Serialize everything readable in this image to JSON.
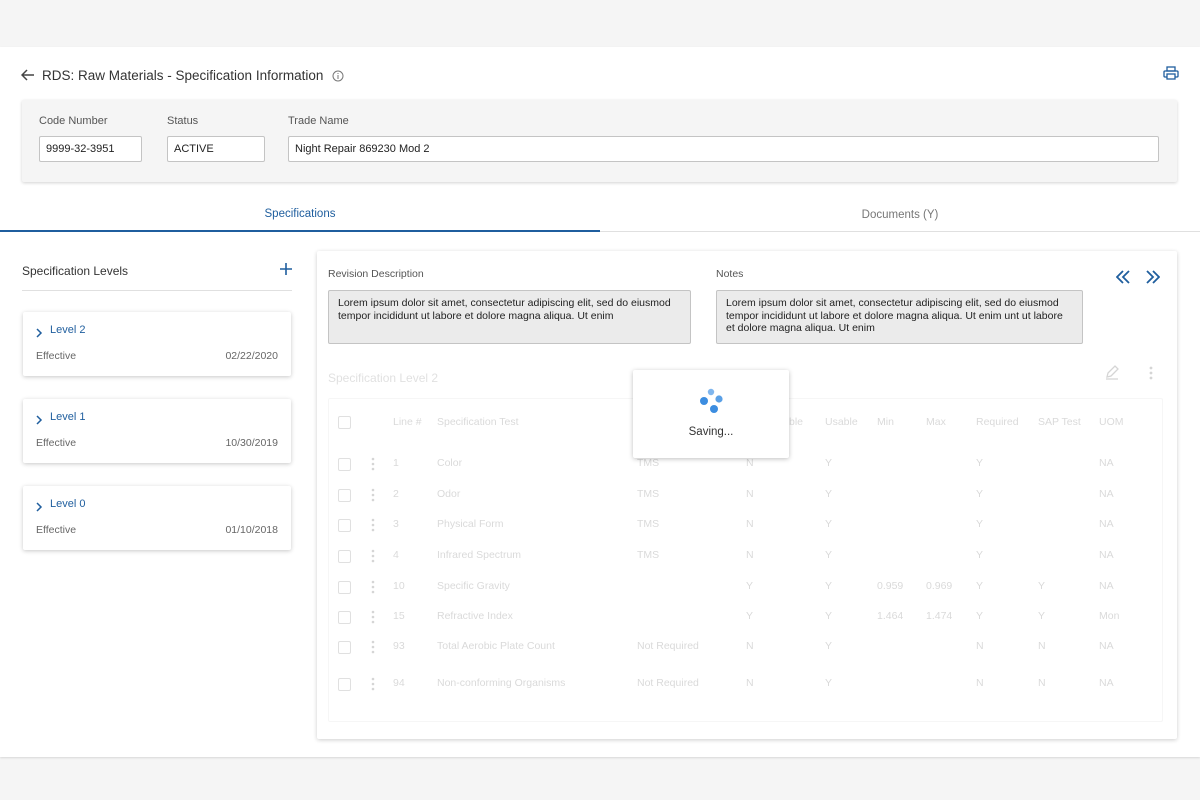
{
  "header": {
    "title": "RDS: Raw Materials - Specification Information",
    "accent_color": "#1f5e9e"
  },
  "fields": {
    "code_number": {
      "label": "Code Number",
      "value": "9999-32-3951"
    },
    "status": {
      "label": "Status",
      "value": "ACTIVE"
    },
    "trade_name": {
      "label": "Trade Name",
      "value": "Night Repair 869230 Mod 2"
    }
  },
  "tabs": [
    {
      "label": "Specifications",
      "active": true
    },
    {
      "label": "Documents (Y)",
      "active": false
    }
  ],
  "spec_levels": {
    "title": "Specification Levels",
    "items": [
      {
        "name": "Level 2",
        "status": "Effective",
        "date": "02/22/2020"
      },
      {
        "name": "Level 1",
        "status": "Effective",
        "date": "10/30/2019"
      },
      {
        "name": "Level 0",
        "status": "Effective",
        "date": "01/10/2018"
      }
    ]
  },
  "detail": {
    "revision_label": "Revision Description",
    "revision_text": "Lorem ipsum dolor sit amet, consectetur adipiscing elit, sed do eiusmod tempor incididunt ut labore et dolore magna aliqua. Ut enim",
    "notes_label": "Notes",
    "notes_text": "Lorem ipsum dolor sit amet, consectetur adipiscing elit, sed do eiusmod tempor incididunt ut labore et dolore magna aliqua. Ut enim unt ut labore et dolore magna aliqua. Ut enim",
    "spec_title": "Specification Level 2"
  },
  "table": {
    "headers": [
      "Line #",
      "Specification Test",
      "",
      "",
      "Usable",
      "Min",
      "Max",
      "Required",
      "SAP Test",
      "UOM"
    ],
    "header_partial_usable": "ble",
    "rows": [
      {
        "line": "1",
        "test": "Color",
        "method": "TMS",
        "c1": "N",
        "usable": "Y",
        "min": "",
        "max": "",
        "required": "Y",
        "sap": "",
        "uom": "NA"
      },
      {
        "line": "2",
        "test": "Odor",
        "method": "TMS",
        "c1": "N",
        "usable": "Y",
        "min": "",
        "max": "",
        "required": "Y",
        "sap": "",
        "uom": "NA"
      },
      {
        "line": "3",
        "test": "Physical Form",
        "method": "TMS",
        "c1": "N",
        "usable": "Y",
        "min": "",
        "max": "",
        "required": "Y",
        "sap": "",
        "uom": "NA"
      },
      {
        "line": "4",
        "test": "Infrared Spectrum",
        "method": "TMS",
        "c1": "N",
        "usable": "Y",
        "min": "",
        "max": "",
        "required": "Y",
        "sap": "",
        "uom": "NA"
      },
      {
        "line": "10",
        "test": "Specific Gravity",
        "method": "",
        "c1": "Y",
        "usable": "Y",
        "min": "0.959",
        "max": "0.969",
        "required": "Y",
        "sap": "Y",
        "uom": "NA"
      },
      {
        "line": "15",
        "test": "Refractive Index",
        "method": "",
        "c1": "Y",
        "usable": "Y",
        "min": "1.464",
        "max": "1.474",
        "required": "Y",
        "sap": "Y",
        "uom": "Mon"
      },
      {
        "line": "93",
        "test": "Total Aerobic Plate Count",
        "method": "Not Required",
        "c1": "N",
        "usable": "Y",
        "min": "",
        "max": "",
        "required": "N",
        "sap": "N",
        "uom": "NA"
      },
      {
        "line": "94",
        "test": "Non-conforming Organisms",
        "method": "Not Required",
        "c1": "N",
        "usable": "Y",
        "min": "",
        "max": "",
        "required": "N",
        "sap": "N",
        "uom": "NA"
      }
    ]
  },
  "overlay": {
    "saving_text": "Saving..."
  }
}
